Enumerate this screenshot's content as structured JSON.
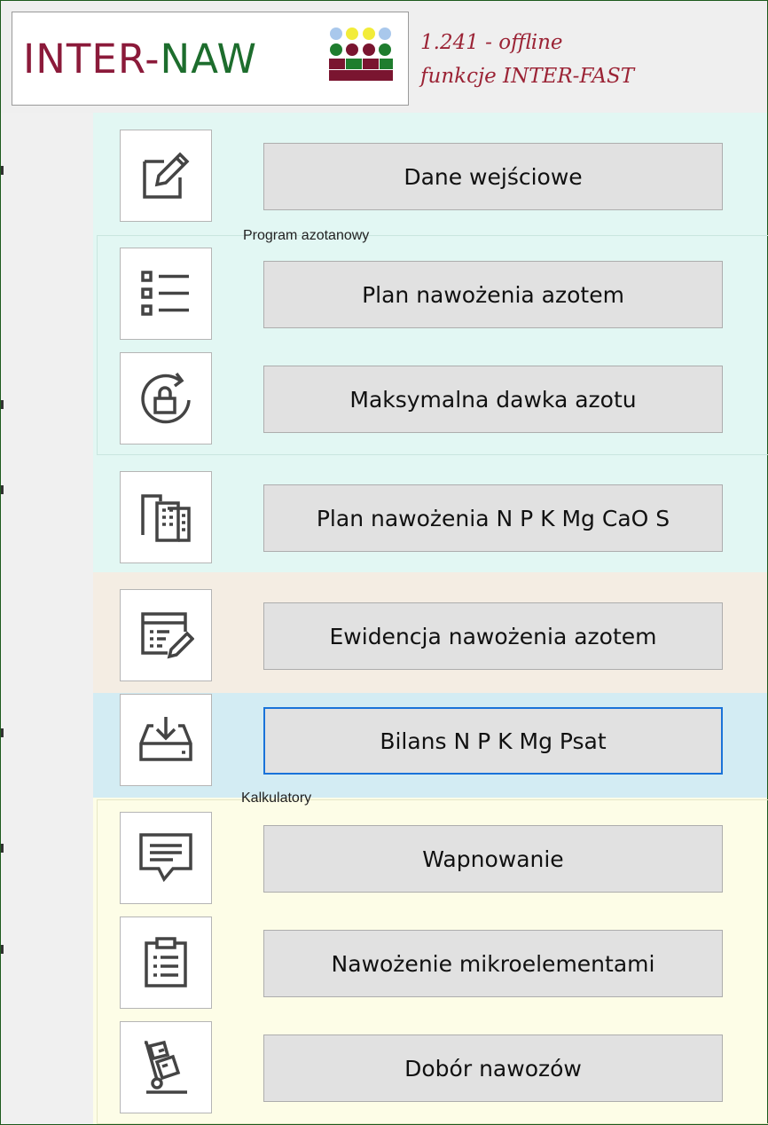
{
  "header": {
    "logo_inter": "INTER-",
    "logo_naw": "NAW",
    "version_line": "1.241 - offline",
    "subtitle_line": "funkcje INTER-FAST"
  },
  "groups": {
    "program_azotanowy": "Program azotanowy",
    "kalkulatory": "Kalkulatory"
  },
  "menu": [
    {
      "label": "Dane wejściowe",
      "icon": "edit-icon"
    },
    {
      "label": "Plan nawożenia azotem",
      "icon": "checklist-icon"
    },
    {
      "label": "Maksymalna dawka azotu",
      "icon": "lock-rotate-icon"
    },
    {
      "label": "Plan nawożenia N P K Mg CaO S",
      "icon": "buildings-icon"
    },
    {
      "label": "Ewidencja nawożenia azotem",
      "icon": "form-edit-icon"
    },
    {
      "label": "Bilans N P K Mg Psat",
      "icon": "inbox-download-icon"
    },
    {
      "label": "Wapnowanie",
      "icon": "comment-icon"
    },
    {
      "label": "Nawożenie mikroelementami",
      "icon": "clipboard-list-icon"
    },
    {
      "label": "Dobór nawozów",
      "icon": "hand-truck-icon"
    }
  ],
  "colors": {
    "mint": "#e2f7f3",
    "beige": "#f4ede3",
    "blue": "#d3ecf3",
    "yellow": "#fdfde7",
    "focus": "#1a73d9",
    "logo_red": "#8b1a3a",
    "logo_green": "#1d6d2d"
  }
}
